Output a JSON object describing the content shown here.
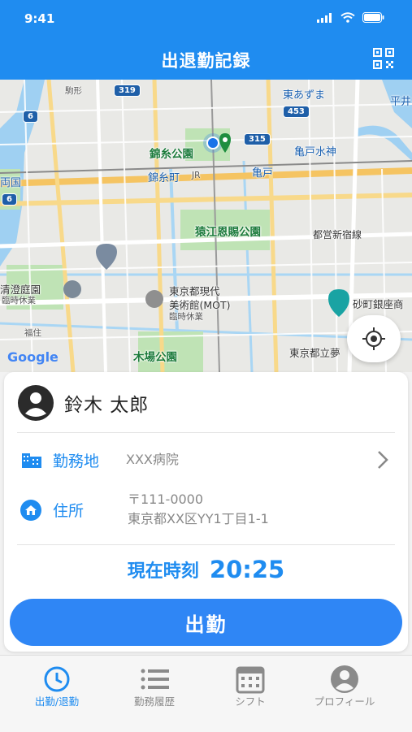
{
  "status_bar": {
    "time": "9:41"
  },
  "header": {
    "title": "出退勤記録",
    "qr_icon": "qr-code-icon"
  },
  "map": {
    "labels": {
      "azuma": "東あずま",
      "kinshi_park": "錦糸公園",
      "kinshicho": "錦糸町",
      "kameido_suijin": "亀戸水神",
      "kameido": "亀戸",
      "ryogoku": "両国",
      "sarue_park": "猿江恩賜公園",
      "shinjuku_line": "都営新宿線",
      "kiyosumi": "清澄庭園",
      "kiyosumi_closed": "臨時休業",
      "mot_1": "東京都現代",
      "mot_2": "美術館(MOT)",
      "mot_closed": "臨時休業",
      "sunamachi": "砂町銀座商",
      "fukuzumi": "福住",
      "kiba_park": "木場公園",
      "tokyo_toritsu": "東京都立夢",
      "hirai": "平井",
      "rail_kinshicho": "JR",
      "road_319": "319",
      "road_315": "315",
      "road_453": "453",
      "road_6a": "6",
      "road_6b": "6",
      "attribution": "Google",
      "koma": "駒形"
    }
  },
  "card": {
    "user_name": "鈴木 太郎",
    "workplace_label": "勤務地",
    "workplace_value": "XXX病院",
    "address_label": "住所",
    "address_postal": "〒111-0000",
    "address_line": "東京都XX区YY1丁目1-1",
    "time_label": "現在時刻",
    "time_value": "20:25",
    "checkin_button": "出勤"
  },
  "tabs": [
    {
      "label": "出勤/退勤",
      "icon": "clock-icon",
      "active": true
    },
    {
      "label": "勤務履歴",
      "icon": "list-icon",
      "active": false
    },
    {
      "label": "シフト",
      "icon": "calendar-icon",
      "active": false
    },
    {
      "label": "プロフィール",
      "icon": "profile-icon",
      "active": false
    }
  ],
  "colors": {
    "primary": "#1f8cf0",
    "button": "#2f86f5",
    "inactive": "#8a8a8a"
  }
}
